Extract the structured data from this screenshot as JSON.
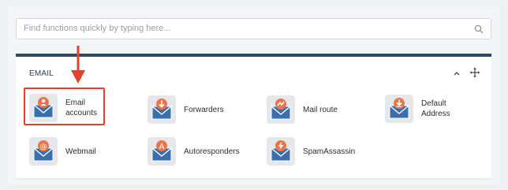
{
  "search": {
    "placeholder": "Find functions quickly by typing here..."
  },
  "panel": {
    "title": "EMAIL",
    "items": [
      {
        "label": "Email\naccounts",
        "icon": "email-accounts-icon",
        "badge": "person",
        "highlighted": true
      },
      {
        "label": "Forwarders",
        "icon": "forwarders-icon",
        "badge": "arrow-down"
      },
      {
        "label": "Mail route",
        "icon": "mail-route-icon",
        "badge": "routes"
      },
      {
        "label": "Default\nAddress",
        "icon": "default-address-icon",
        "badge": "arrow-down"
      },
      {
        "label": "Webmail",
        "icon": "webmail-icon",
        "badge": "@"
      },
      {
        "label": "Autoresponders",
        "icon": "autoresponders-icon",
        "badge": "A"
      },
      {
        "label": "SpamAssassin",
        "icon": "spamassassin-icon",
        "badge": "bolt"
      }
    ]
  },
  "colors": {
    "panel_border": "#2f4a5e",
    "envelope_blue": "#3a6fae",
    "badge_orange": "#e8764a",
    "highlight_red": "#e0432b"
  }
}
